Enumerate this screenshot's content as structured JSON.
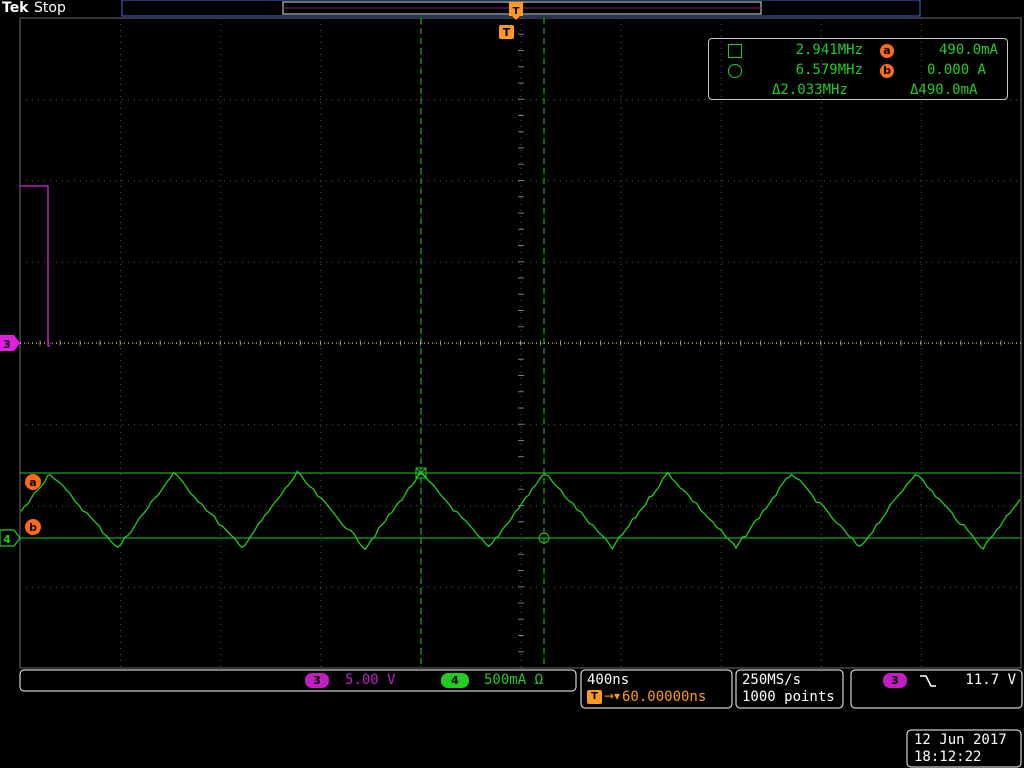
{
  "header": {
    "brand": "Tek",
    "run_state": "Stop",
    "trigger_marker": "T"
  },
  "measurements": {
    "cursor1_freq": "2.941MHz",
    "cursor1_badge": "a",
    "cursor1_value": "490.0mA",
    "cursor2_freq": "6.579MHz",
    "cursor2_badge": "b",
    "cursor2_value": "0.000 A",
    "delta_freq": "Δ2.033MHz",
    "delta_value": "Δ490.0mA"
  },
  "channels": {
    "ch3": {
      "marker": "3",
      "color": "#e020e0"
    },
    "ch4": {
      "marker": "4",
      "color": "#22cc22"
    },
    "cursor_a_marker": "a",
    "cursor_b_marker": "b"
  },
  "status_bar": {
    "ch3_badge": "3",
    "ch3_scale": "5.00 V",
    "ch4_badge": "4",
    "ch4_scale": "500mA Ω",
    "timebase": "400ns",
    "trigger_position": "60.00000ns",
    "sample_rate": "250MS/s",
    "record_length": "1000 points",
    "trigger_source_badge": "3",
    "trigger_slope": "falling",
    "trigger_level": "11.7 V"
  },
  "datetime": {
    "date": "12 Jun 2017",
    "time": "18:12:22"
  }
}
